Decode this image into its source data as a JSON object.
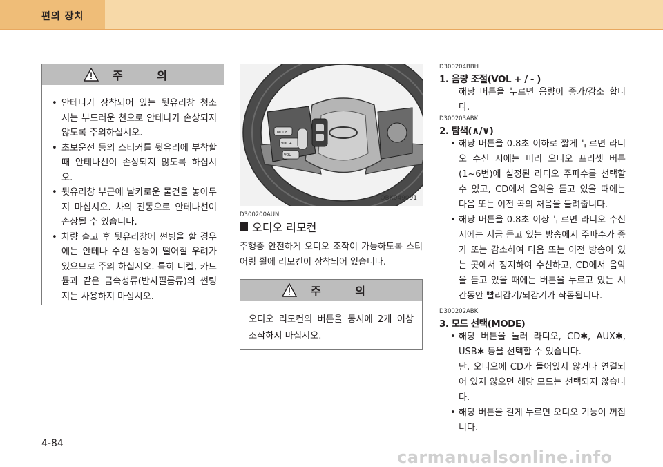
{
  "header": {
    "title": "편의 장치"
  },
  "caution_left": {
    "title": "주  의",
    "items": [
      "안테나가 장착되어 있는 뒷유리창 청소 시는 부드러운 천으로 안테나가 손상되지 않도록 주의하십시오.",
      "초보운전 등의 스티커를 뒷유리에 부착할 때 안테나선이 손상되지 않도록 하십시오.",
      "뒷유리창 부근에 날카로운 물건을 놓아두지 마십시오. 차의 진동으로 안테나선이 손상될 수 있습니다.",
      "차량 출고 후 뒷유리창에 썬팅을 할 경우에는 안테나 수신 성능이 떨어질 우려가 있으므로 주의 하십시오. 특히 니켈, 카드뮴과 같은 금속성류(반사필름류)의 썬팅지는 사용하지 마십시오."
    ]
  },
  "figure": {
    "label": "OBK049091",
    "btn_mode": "MODE",
    "btn_vol_plus": "VOL +",
    "btn_vol_minus": "VOL -"
  },
  "audio_remote": {
    "code": "D300200AUN",
    "title": "오디오 리모컨",
    "body": "주행중 안전하게 오디오 조작이 가능하도록 스티어링 휠에 리모컨이 장착되어 있습니다."
  },
  "caution_mid": {
    "title": "주  의",
    "body": "오디오 리모컨의 버튼을 동시에 2개 이상 조작하지 마십시오."
  },
  "right": {
    "s1": {
      "code": "D300204BBH",
      "heading": "1. 음량 조절(VOL + / - )",
      "text": "해당 버튼을 누르면 음량이 증가/감소 합니다."
    },
    "s2": {
      "code": "D300203ABK",
      "heading": "2. 탐색(∧/∨)",
      "items": [
        "해당 버튼을 0.8초 이하로 짧게 누르면 라디오 수신 시에는 미리 오디오 프리셋 버튼(1~6번)에 설정된 라디오 주파수를 선택할 수 있고, CD에서 음악을 듣고 있을 때에는 다음 또는 이전 곡의 처음을 들려줍니다.",
        "해당 버튼을 0.8초 이상 누르면 라디오 수신 시에는 지금 듣고 있는 방송에서 주파수가 증가 또는 감소하여 다음 또는 이전 방송이 있는 곳에서 정지하여 수신하고, CD에서 음악을 듣고 있을 때에는 버튼을 누르고 있는 시간동안 빨리감기/되감기가 작동됩니다."
      ]
    },
    "s3": {
      "code": "D300202ABK",
      "heading": "3. 모드 선택(MODE)",
      "item1": "해당 버튼을 눌러 라디오, CD✱, AUX✱, USB✱ 등을 선택할 수 있습니다.",
      "item1_note": "단, 오디오에 CD가 들어있지 않거나 연결되어 있지 않으면 해당 모드는 선택되지 않습니다.",
      "item2": "해당 버튼을 길게 누르면 오디오 기능이 꺼집니다."
    }
  },
  "footer": {
    "page": "4-84",
    "watermark": "carmanualsonline.info"
  }
}
